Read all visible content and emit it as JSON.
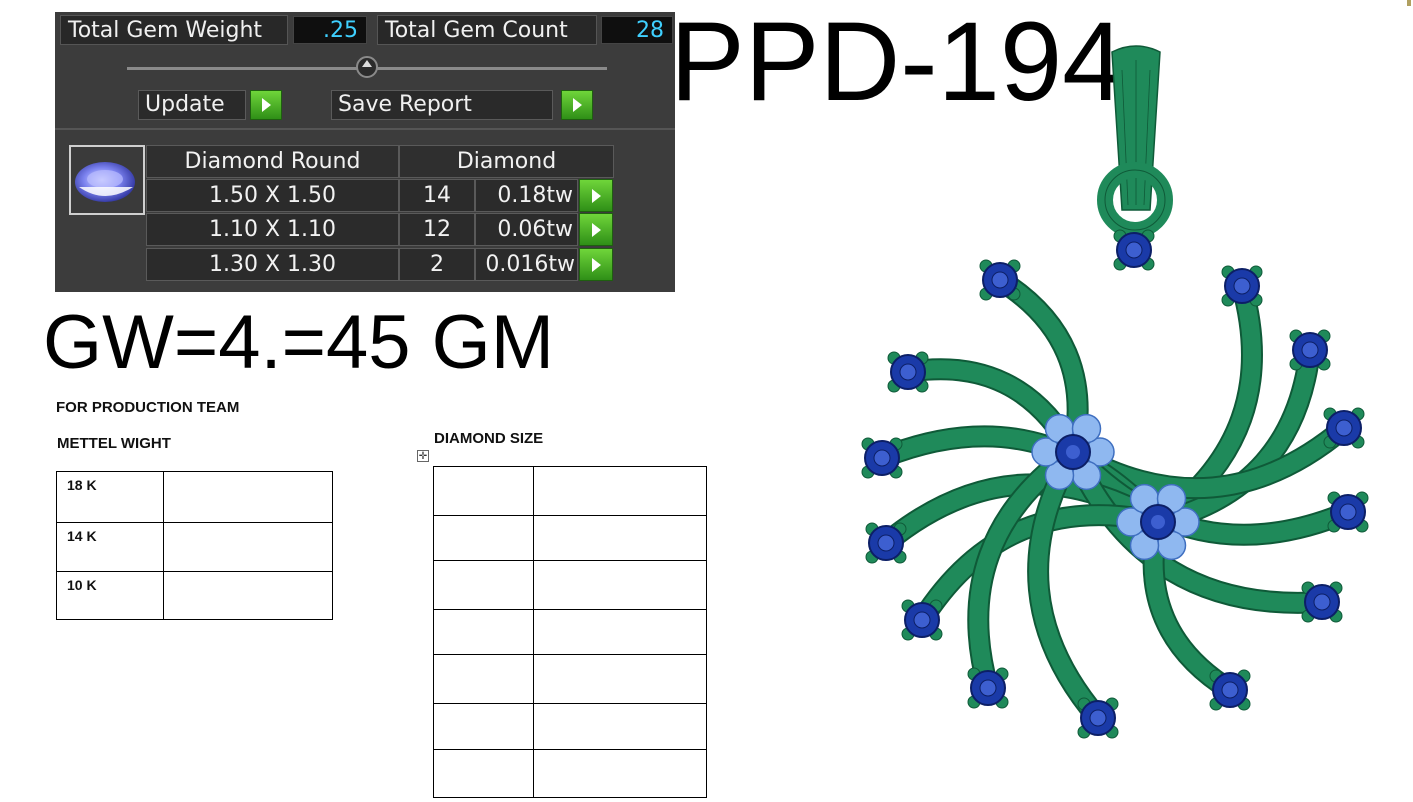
{
  "gem_panel": {
    "total_gem_weight_label": "Total Gem Weight",
    "total_gem_weight_value": ".25",
    "total_gem_count_label": "Total Gem Count",
    "total_gem_count_value": "28",
    "update_label": "Update",
    "save_report_label": "Save Report",
    "table": {
      "header_shape": "Diamond Round",
      "header_type": "Diamond",
      "rows": [
        {
          "size": "1.50 X 1.50",
          "count": "14",
          "weight": "0.18tw"
        },
        {
          "size": "1.10 X 1.10",
          "count": "12",
          "weight": "0.06tw"
        },
        {
          "size": "1.30 X 1.30",
          "count": "2",
          "weight": "0.016tw"
        }
      ]
    }
  },
  "design_code": "PPD-194",
  "gross_weight": "GW=4.=45 GM",
  "production": {
    "heading": "FOR PRODUCTION TEAM",
    "metal_weight_heading": "METTEL WIGHT",
    "metal_rows": [
      {
        "karat": "18 K",
        "weight": ""
      },
      {
        "karat": "14 K",
        "weight": ""
      },
      {
        "karat": "10 K",
        "weight": ""
      }
    ],
    "diamond_size_heading": "DIAMOND SIZE"
  },
  "colors": {
    "panel_bg": "#3c3c3c",
    "value_text": "#3fd0ff",
    "go_button": "#4bb82a",
    "metal": "#1f8a5a",
    "stone_main": "#1a3aa8",
    "stone_pave": "#8fb8f0"
  },
  "icons": {
    "gem_thumbnail": "round-diamond-icon",
    "slider": "slider-knob-icon",
    "go": "play-arrow-icon",
    "move_table": "move-cross-icon"
  }
}
